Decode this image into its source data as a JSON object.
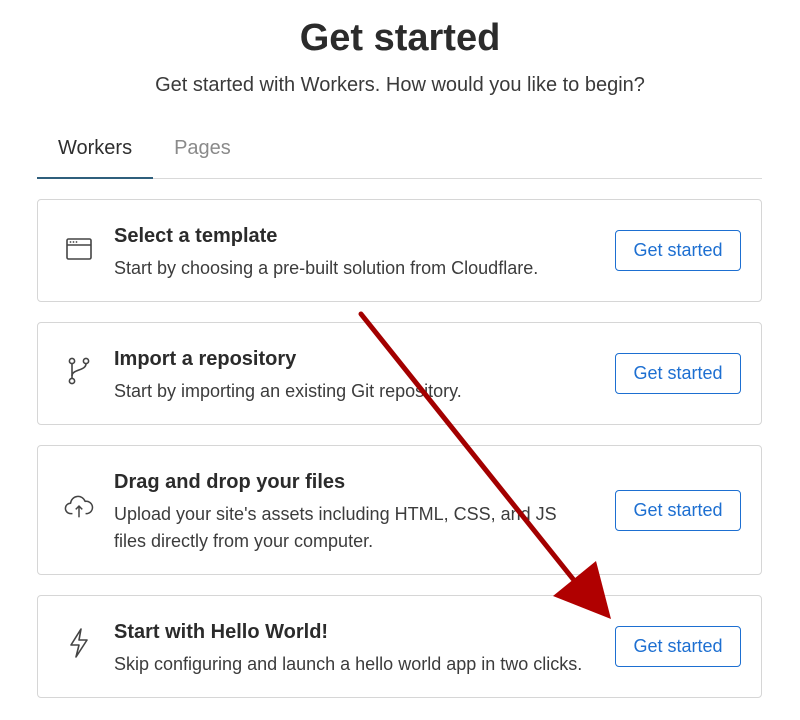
{
  "header": {
    "title": "Get started",
    "subtitle": "Get started with Workers. How would you like to begin?"
  },
  "tabs": [
    {
      "label": "Workers",
      "active": true
    },
    {
      "label": "Pages",
      "active": false
    }
  ],
  "cards": [
    {
      "icon": "browser-window-icon",
      "title": "Select a template",
      "description": "Start by choosing a pre-built solution from Cloudflare.",
      "button": "Get started"
    },
    {
      "icon": "git-branch-icon",
      "title": "Import a repository",
      "description": "Start by importing an existing Git repository.",
      "button": "Get started"
    },
    {
      "icon": "cloud-upload-icon",
      "title": "Drag and drop your files",
      "description": "Upload your site's assets including HTML, CSS, and JS files directly from your computer.",
      "button": "Get started"
    },
    {
      "icon": "lightning-bolt-icon",
      "title": "Start with Hello World!",
      "description": "Skip configuring and launch a hello world app in two clicks.",
      "button": "Get started"
    }
  ],
  "colors": {
    "accent": "#1d6fd1",
    "tab_underline": "#2f5f7c",
    "annotation_arrow": "#b00000"
  }
}
